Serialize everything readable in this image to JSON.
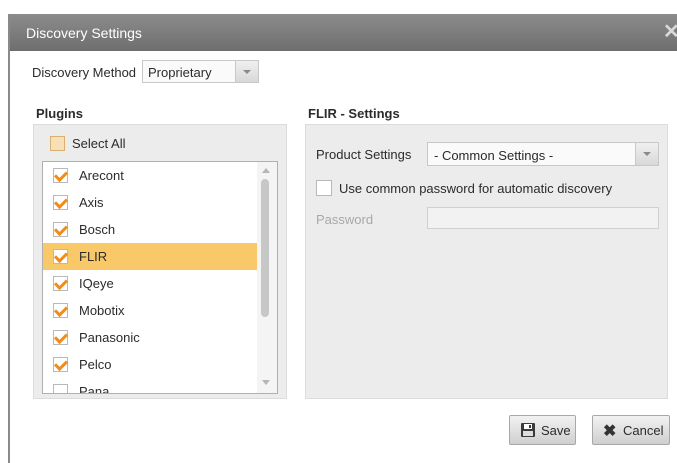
{
  "dialog": {
    "title": "Discovery Settings",
    "close_glyph": "✕"
  },
  "discovery": {
    "label": "Discovery Method",
    "value": "Proprietary"
  },
  "plugins": {
    "heading": "Plugins",
    "select_all_label": "Select All",
    "items": [
      {
        "label": "Arecont",
        "checked": true
      },
      {
        "label": "Axis",
        "checked": true
      },
      {
        "label": "Bosch",
        "checked": true
      },
      {
        "label": "FLIR",
        "checked": true,
        "selected": true
      },
      {
        "label": "IQeye",
        "checked": true
      },
      {
        "label": "Mobotix",
        "checked": true
      },
      {
        "label": "Panasonic",
        "checked": true
      },
      {
        "label": "Pelco",
        "checked": true
      },
      {
        "label": "Pana...",
        "checked": false
      }
    ]
  },
  "settings": {
    "heading": "FLIR - Settings",
    "product_label": "Product Settings",
    "product_value": "- Common Settings -",
    "common_pw_label": "Use common password for automatic discovery",
    "password_label": "Password",
    "password_value": ""
  },
  "buttons": {
    "save_label": "Save",
    "cancel_label": "Cancel"
  },
  "colors": {
    "accent": "#f08c1a",
    "selection": "#f9c969",
    "titlebar": "#7d7d7d"
  }
}
